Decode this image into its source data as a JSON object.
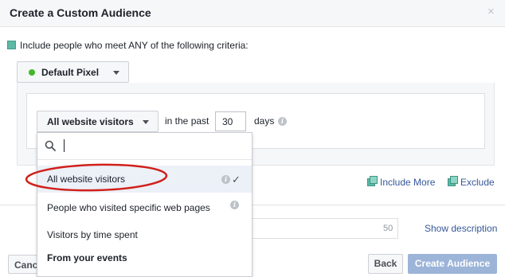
{
  "dialog": {
    "title": "Create a Custom Audience",
    "close_glyph": "×"
  },
  "criteria": {
    "include_text": "Include people who meet ANY of the following criteria:"
  },
  "pixel": {
    "label": "Default Pixel",
    "status_color": "#42b72a"
  },
  "rule": {
    "visitor_select_label": "All website visitors",
    "in_the_past_label": "in the past",
    "days_value": "30",
    "days_label": "days"
  },
  "dropdown": {
    "search_placeholder": "",
    "items": [
      {
        "label": "All website visitors",
        "selected": true,
        "has_info": true
      },
      {
        "label": "People who visited specific web pages",
        "selected": false,
        "has_info": true
      },
      {
        "label": "Visitors by time spent",
        "selected": false,
        "has_info": false
      }
    ],
    "section_header": "From your events",
    "check_glyph": "✓",
    "info_glyph": "i"
  },
  "actions": {
    "include_more": "Include More",
    "exclude": "Exclude"
  },
  "description": {
    "char_limit": "50",
    "show_description": "Show description"
  },
  "footer": {
    "cancel_label": "Cancel",
    "back_label": "Back",
    "create_label": "Create Audience"
  },
  "colors": {
    "accent_link": "#365899",
    "create_button_disabled": "#9cb4d8",
    "annotation": "#d0201a",
    "selected_row": "#ecf0f7"
  }
}
